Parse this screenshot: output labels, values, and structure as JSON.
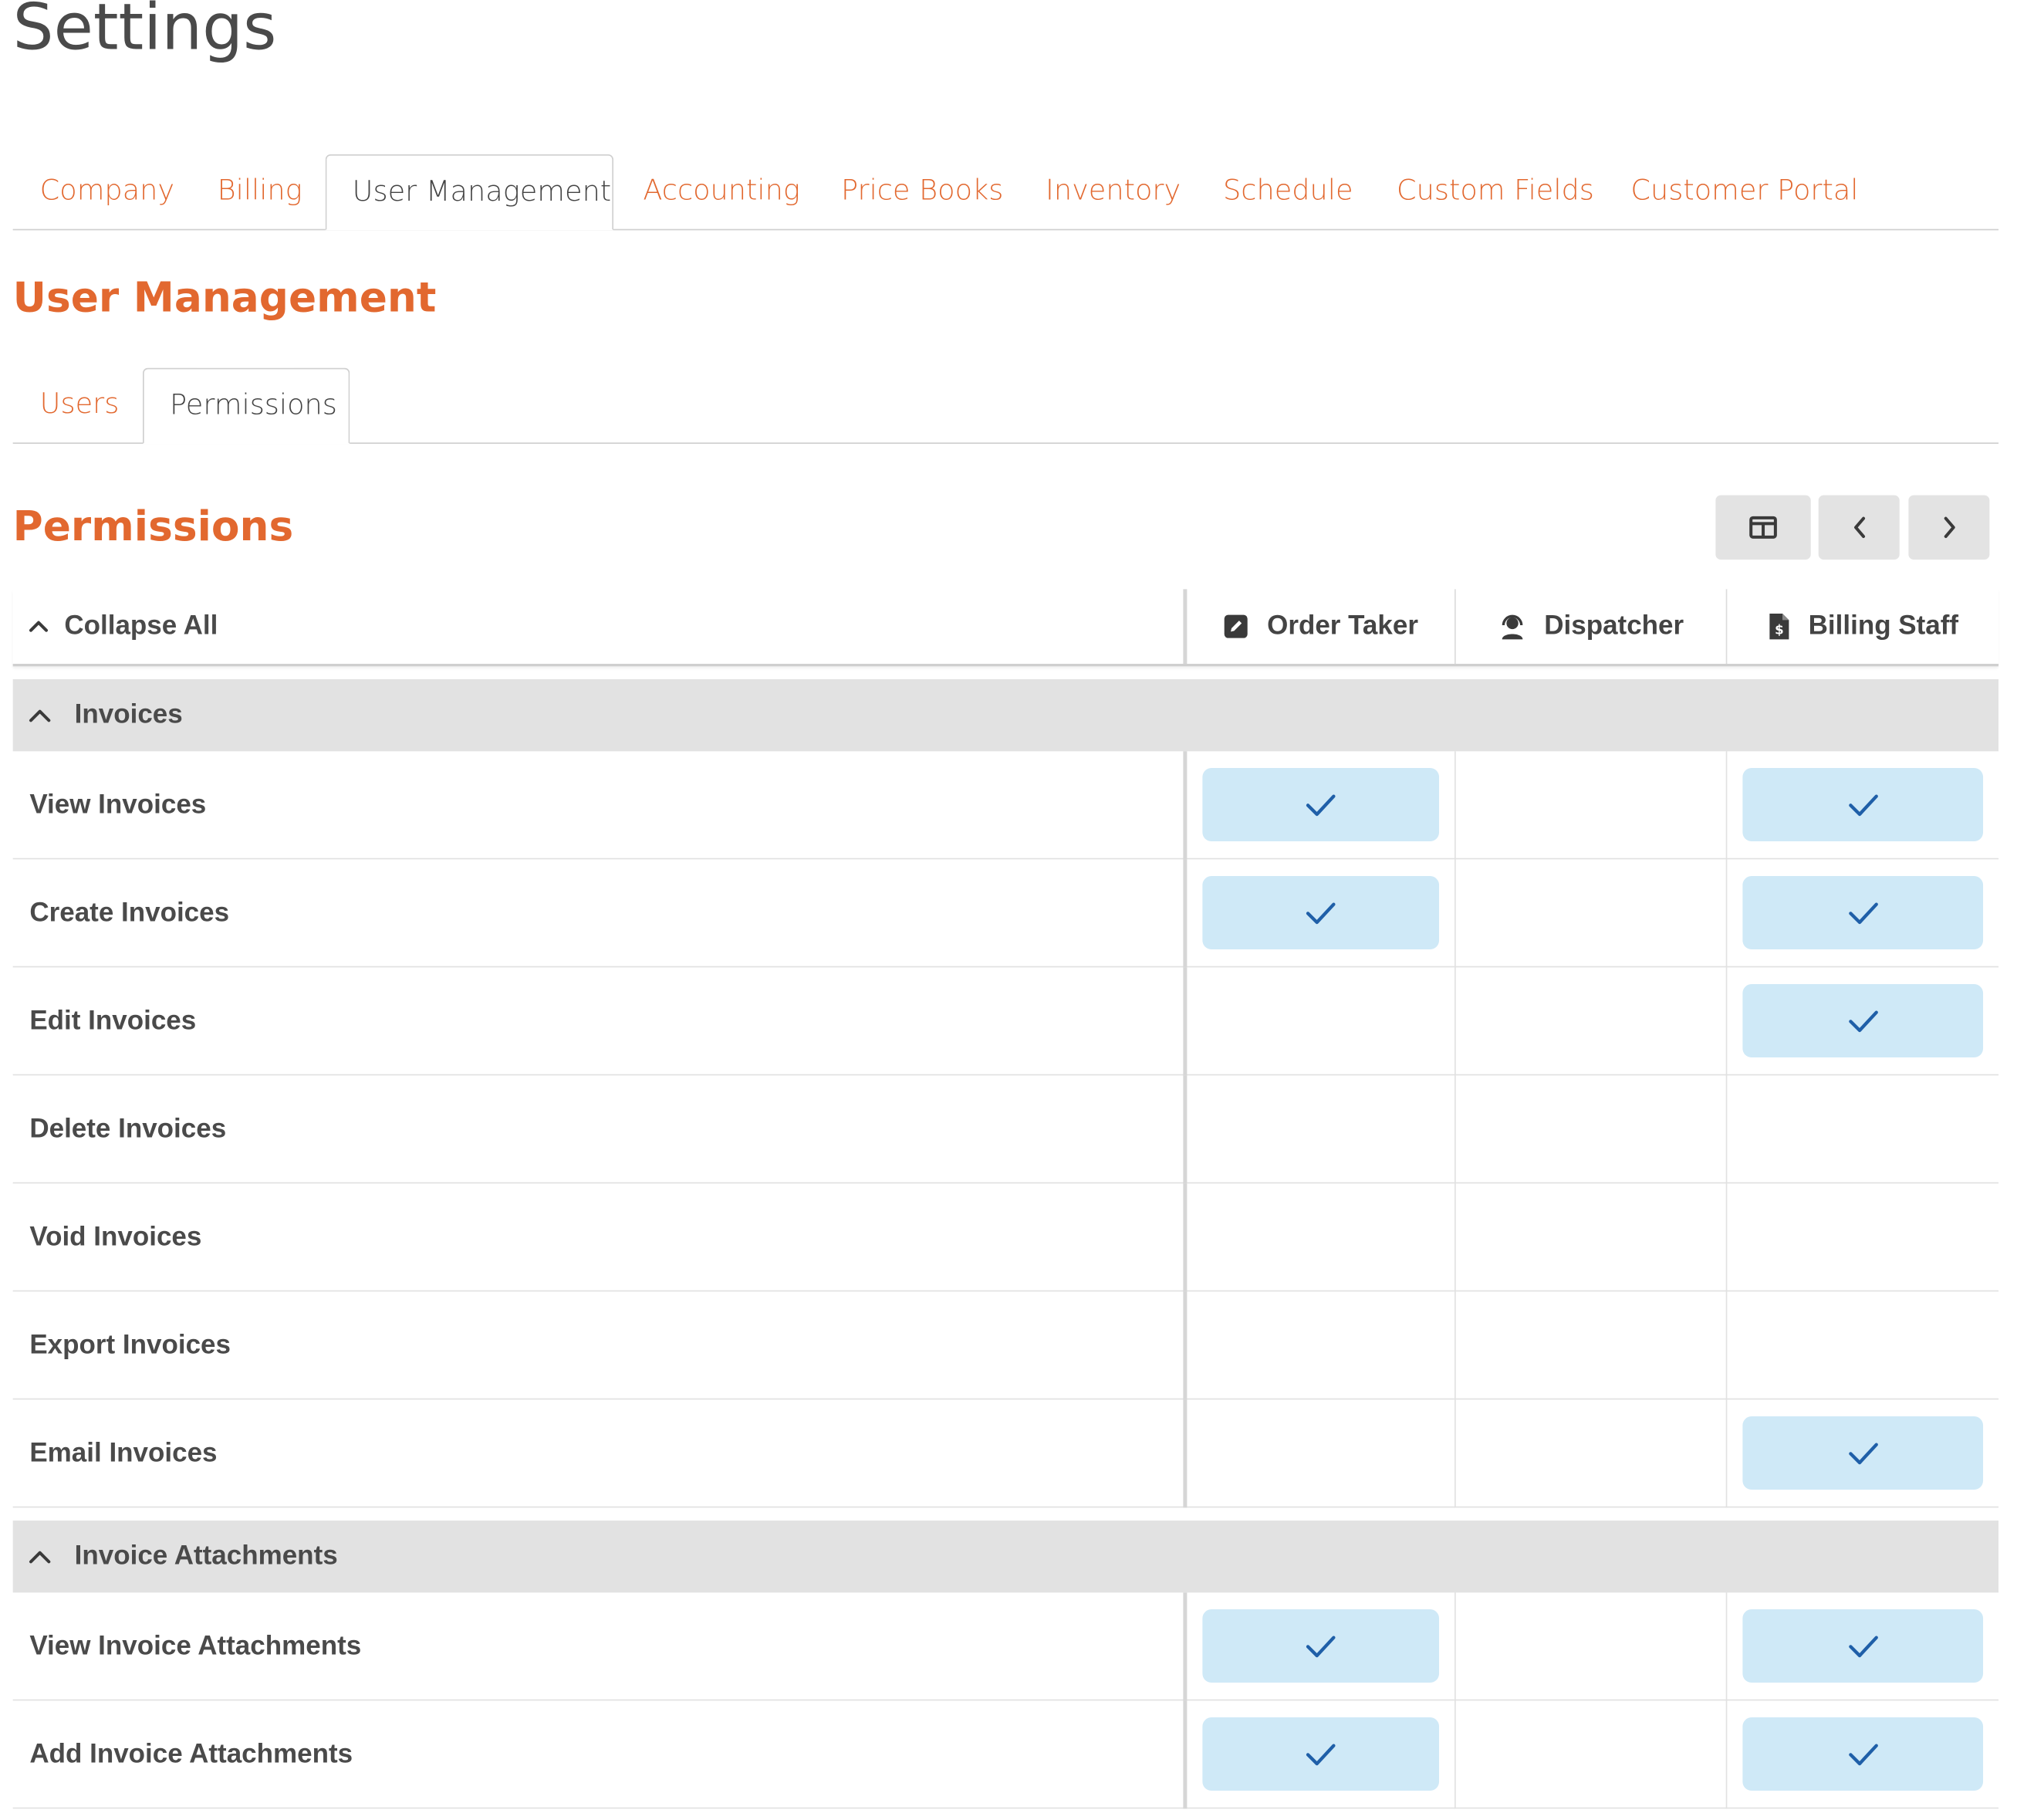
{
  "page": {
    "title": "Settings"
  },
  "main_tabs": [
    {
      "label": "Company",
      "active": false
    },
    {
      "label": "Billing",
      "active": false
    },
    {
      "label": "User Management",
      "active": true
    },
    {
      "label": "Accounting",
      "active": false
    },
    {
      "label": "Price Books",
      "active": false
    },
    {
      "label": "Inventory",
      "active": false
    },
    {
      "label": "Schedule",
      "active": false
    },
    {
      "label": "Custom Fields",
      "active": false
    },
    {
      "label": "Customer Portal",
      "active": false
    }
  ],
  "section": {
    "title": "User Management"
  },
  "sub_tabs": [
    {
      "label": "Users",
      "active": false
    },
    {
      "label": "Permissions",
      "active": true
    }
  ],
  "permissions": {
    "title": "Permissions",
    "toolbar": {
      "icons": [
        "columns-icon",
        "chevron-left-icon",
        "chevron-right-icon"
      ]
    },
    "collapse_all_label": "Collapse All",
    "columns": [
      {
        "label": "Order Taker",
        "icon": "edit-icon"
      },
      {
        "label": "Dispatcher",
        "icon": "headset-icon"
      },
      {
        "label": "Billing Staff",
        "icon": "invoice-dollar-icon"
      }
    ],
    "groups": [
      {
        "label": "Invoices",
        "rows": [
          {
            "label": "View Invoices",
            "values": [
              true,
              false,
              true
            ]
          },
          {
            "label": "Create Invoices",
            "values": [
              true,
              false,
              true
            ]
          },
          {
            "label": "Edit Invoices",
            "values": [
              false,
              false,
              true
            ]
          },
          {
            "label": "Delete Invoices",
            "values": [
              false,
              false,
              false
            ]
          },
          {
            "label": "Void Invoices",
            "values": [
              false,
              false,
              false
            ]
          },
          {
            "label": "Export Invoices",
            "values": [
              false,
              false,
              false
            ]
          },
          {
            "label": "Email Invoices",
            "values": [
              false,
              false,
              true
            ]
          }
        ]
      },
      {
        "label": "Invoice Attachments",
        "rows": [
          {
            "label": "View Invoice Attachments",
            "values": [
              true,
              false,
              true
            ]
          },
          {
            "label": "Add Invoice Attachments",
            "values": [
              true,
              false,
              true
            ]
          }
        ]
      }
    ]
  },
  "colors": {
    "accent": "#e2682f",
    "check_bg": "#cfe9f7",
    "check_mark": "#1f5fa8",
    "group_bg": "#e2e2e2"
  }
}
